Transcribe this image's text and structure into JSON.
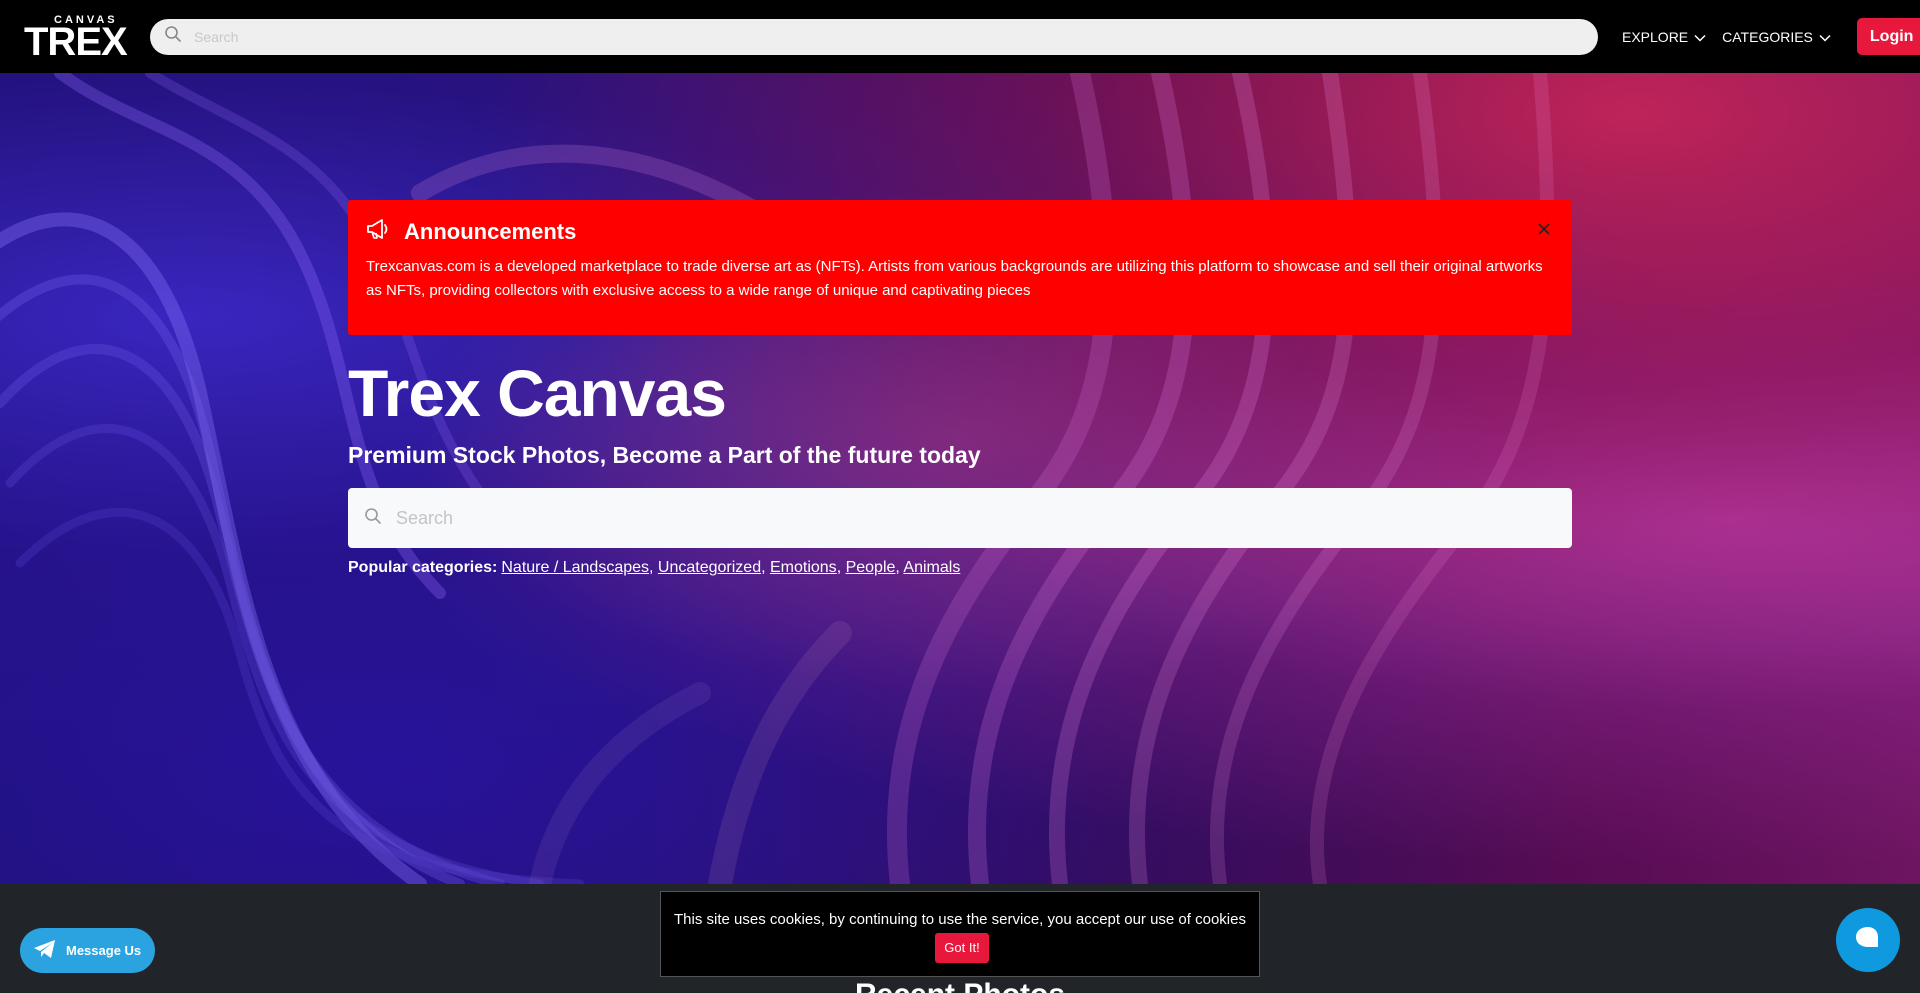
{
  "navbar": {
    "logo_small": "CANVAS",
    "logo_big": "TREX",
    "search_placeholder": "Search",
    "explore_label": "EXPLORE",
    "categories_label": "CATEGORIES",
    "login_label": "Login"
  },
  "announcement": {
    "title": "Announcements",
    "body": "Trexcanvas.com is a developed marketplace to trade diverse art as (NFTs). Artists from various backgrounds are utilizing this platform to showcase and sell their original artworks as NFTs, providing collectors with exclusive access to a wide range of unique and captivating pieces"
  },
  "hero": {
    "title": "Trex Canvas",
    "subtitle": "Premium Stock Photos, Become a Part of the future today",
    "search_placeholder": "Search",
    "popular_label": "Popular categories:",
    "categories": [
      "Nature / Landscapes",
      "Uncategorized",
      "Emotions",
      "People",
      "Animals"
    ]
  },
  "recent": {
    "title": "Recent Photos"
  },
  "message_button": {
    "label": "Message Us"
  },
  "cookie": {
    "text": "This site uses cookies, by continuing to use the service, you accept our use of cookies",
    "button": "Got It!"
  },
  "colors": {
    "accent": "#e8173c",
    "announcement_bg": "#ff0000",
    "telegram": "#2aa3e0",
    "chat": "#0f9ae0"
  }
}
